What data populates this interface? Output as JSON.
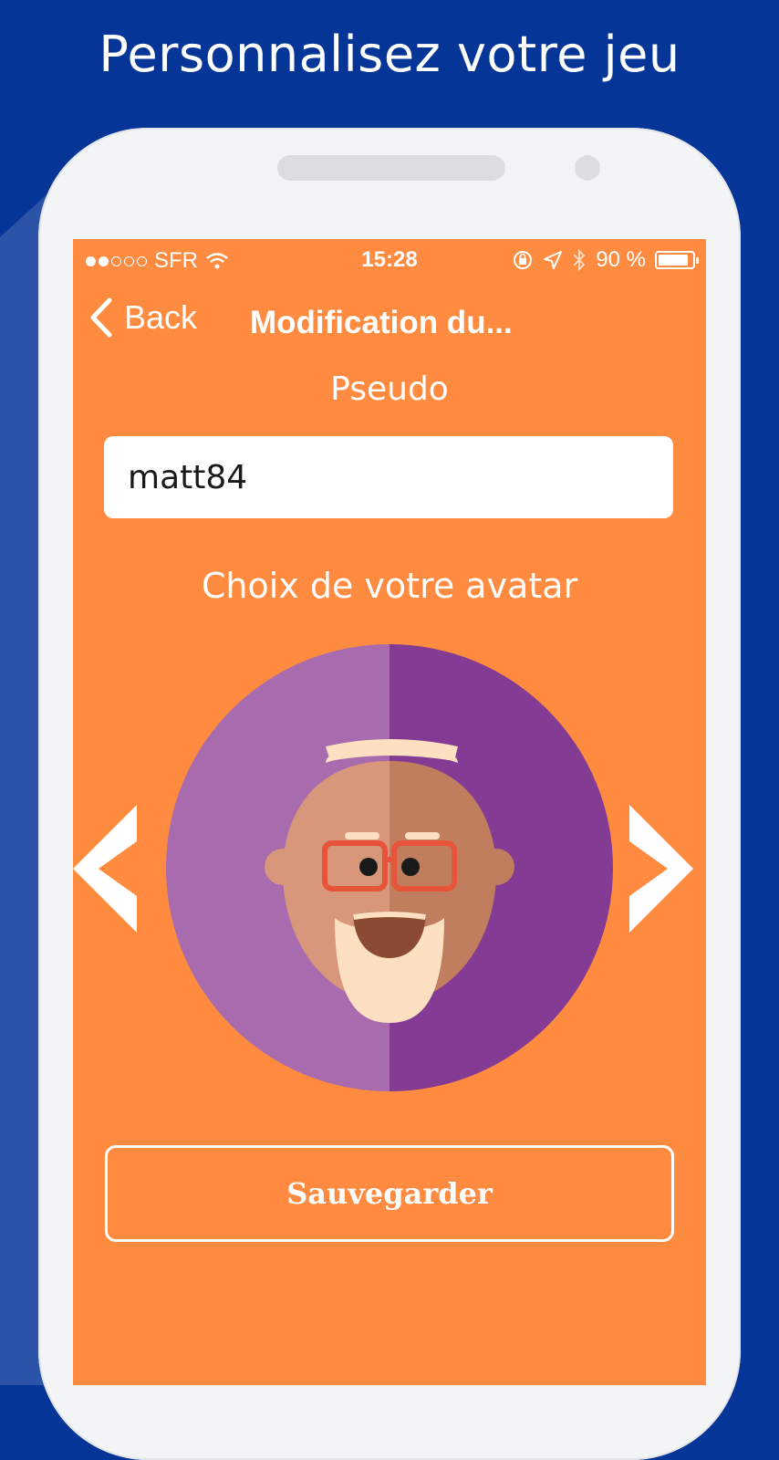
{
  "promo": {
    "title": "Personnalisez votre jeu"
  },
  "status_bar": {
    "carrier": "SFR",
    "time": "15:28",
    "battery": "90 %",
    "battery_level": 0.9,
    "signal_strength": 2
  },
  "nav": {
    "back_label": "Back",
    "title": "Modification du..."
  },
  "form": {
    "pseudo_label": "Pseudo",
    "pseudo_value": "matt84",
    "avatar_label": "Choix de votre avatar",
    "save_label": "Sauvegarder"
  },
  "colors": {
    "background": "#053697",
    "screen": "#fe8b40",
    "avatar_left": "#a86cae",
    "avatar_right": "#843b94"
  },
  "icons": [
    "wifi-icon",
    "lock-rotation-icon",
    "location-icon",
    "bluetooth-icon",
    "battery-icon",
    "back-chevron-icon",
    "arrow-left-icon",
    "arrow-right-icon"
  ]
}
